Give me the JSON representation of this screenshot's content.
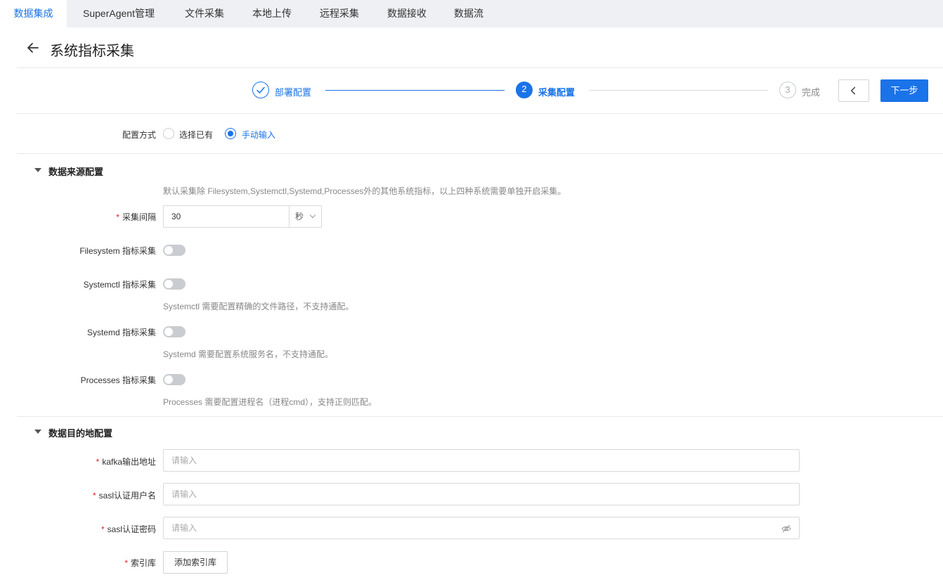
{
  "topnav": {
    "tabs": [
      {
        "label": "数据集成"
      },
      {
        "label": "SuperAgent管理"
      },
      {
        "label": "文件采集"
      },
      {
        "label": "本地上传"
      },
      {
        "label": "远程采集"
      },
      {
        "label": "数据接收"
      },
      {
        "label": "数据流"
      }
    ]
  },
  "header": {
    "title": "系统指标采集"
  },
  "steps": {
    "items": [
      {
        "number": "✓",
        "label": "部署配置",
        "state": "done"
      },
      {
        "number": "2",
        "label": "采集配置",
        "state": "active"
      },
      {
        "number": "3",
        "label": "完成",
        "state": "pending"
      }
    ],
    "next_label": "下一步"
  },
  "mode": {
    "label": "配置方式",
    "options": [
      {
        "label": "选择已有",
        "checked": false
      },
      {
        "label": "手动输入",
        "checked": true
      }
    ]
  },
  "source": {
    "title": "数据来源配置",
    "hint": "默认采集除 Filesystem,Systemctl,Systemd,Processes外的其他系统指标，以上四种系统需要单独开启采集。",
    "interval_label": "采集间隔",
    "interval_value": "30",
    "interval_unit": "秒",
    "toggles": [
      {
        "label": "Filesystem 指标采集",
        "hint": "",
        "on": false
      },
      {
        "label": "Systemctl 指标采集",
        "hint": "Systemctl 需要配置精确的文件路径，不支持通配。",
        "on": false
      },
      {
        "label": "Systemd 指标采集",
        "hint": "Systemd 需要配置系统服务名，不支持通配。",
        "on": false
      },
      {
        "label": "Processes 指标采集",
        "hint": "Processes 需要配置进程名（进程cmd），支持正则匹配。",
        "on": false
      }
    ]
  },
  "destination": {
    "title": "数据目的地配置",
    "kafka_label": "kafka输出地址",
    "kafka_placeholder": "请输入",
    "user_label": "sasl认证用户名",
    "user_placeholder": "请输入",
    "pwd_label": "sasl认证密码",
    "pwd_placeholder": "请输入",
    "index_label": "索引库",
    "index_button": "添加索引库"
  },
  "colors": {
    "accent": "#1a73e8",
    "required": "#e02020"
  }
}
